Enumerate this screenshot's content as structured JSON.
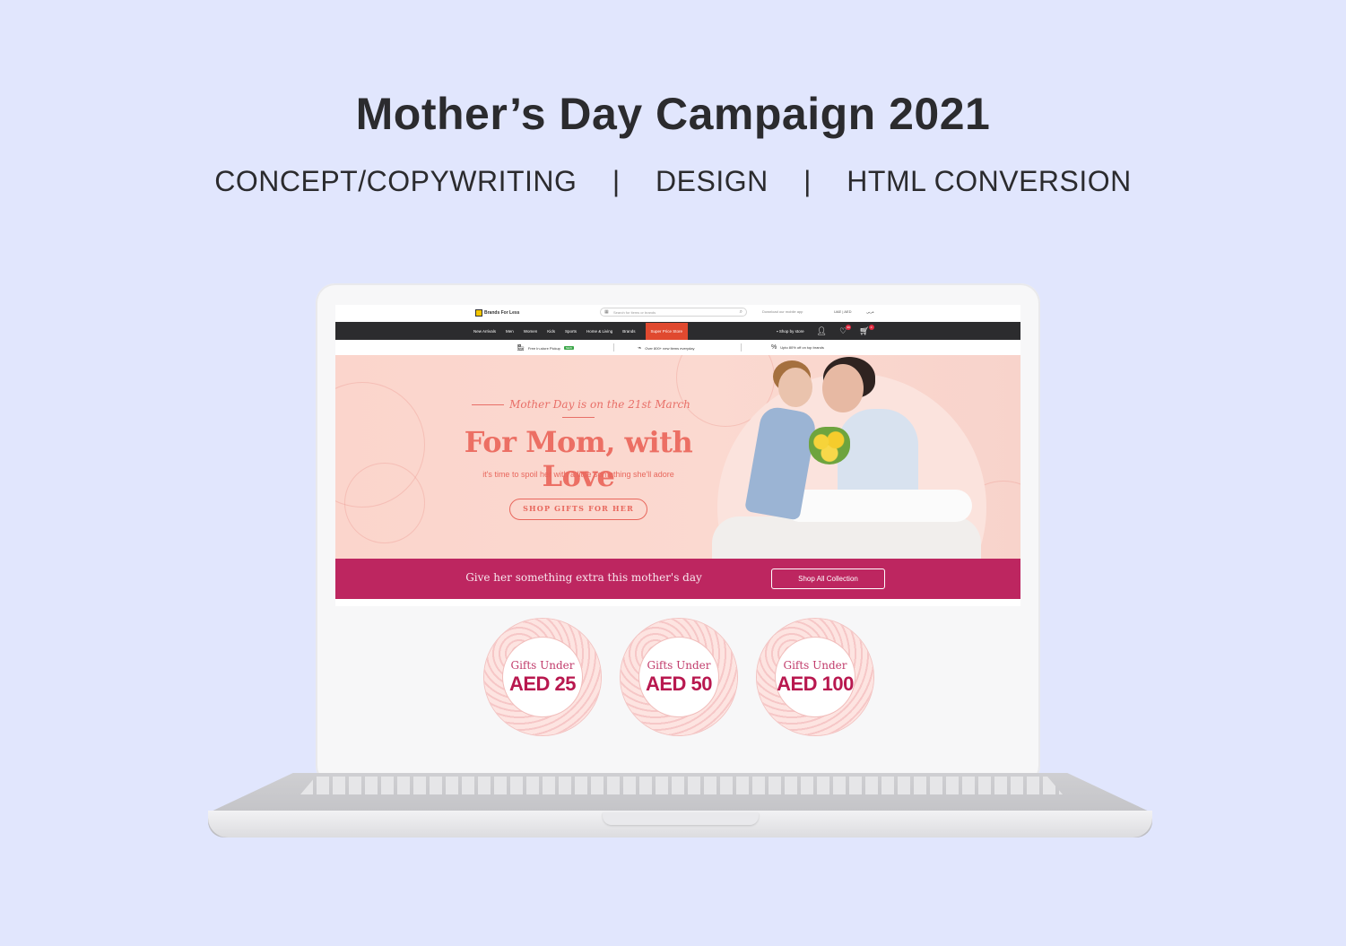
{
  "header": {
    "title": "Mother’s Day Campaign 2021",
    "roles": [
      "CONCEPT/COPYWRITING",
      "DESIGN",
      "HTML CONVERSION"
    ],
    "separator": "|"
  },
  "site": {
    "logo_text": "Brands For Less",
    "search_placeholder": "Search for items or brands",
    "app_download": "Download our mobile app",
    "country": "UAE | AED",
    "language": "عربي",
    "nav_items": [
      "New Arrivals",
      "Men",
      "Women",
      "Kids",
      "Sports",
      "Home & Living",
      "Brands"
    ],
    "nav_highlight": "Super Price Store",
    "shop_by_store": "Shop by store",
    "wishlist_count": "99",
    "cart_count": "0",
    "info_items": [
      {
        "text": "Free In-store Pickup",
        "badge": "NEW"
      },
      {
        "text": "Over 800+ new items everyday"
      },
      {
        "text": "Upto 80% off on top brands"
      }
    ]
  },
  "hero": {
    "date_line": "Mother Day is on the 21st March",
    "title": "For Mom, with Love",
    "subtitle": "it's time to spoil her with a little something she'll adore",
    "button": "SHOP GIFTS FOR HER"
  },
  "promo": {
    "text": "Give her something extra this mother's day",
    "button": "Shop All Collection"
  },
  "gift_circles": [
    {
      "line1": "Gifts Under",
      "line2": "AED 25"
    },
    {
      "line1": "Gifts Under",
      "line2": "AED 50"
    },
    {
      "line1": "Gifts Under",
      "line2": "AED 100"
    }
  ],
  "colors": {
    "background": "#e1e6fd",
    "nav_dark": "#2c2c2e",
    "super_price": "#e0492f",
    "hero_coral": "#ec6f64",
    "promo_magenta": "#bd2660"
  }
}
